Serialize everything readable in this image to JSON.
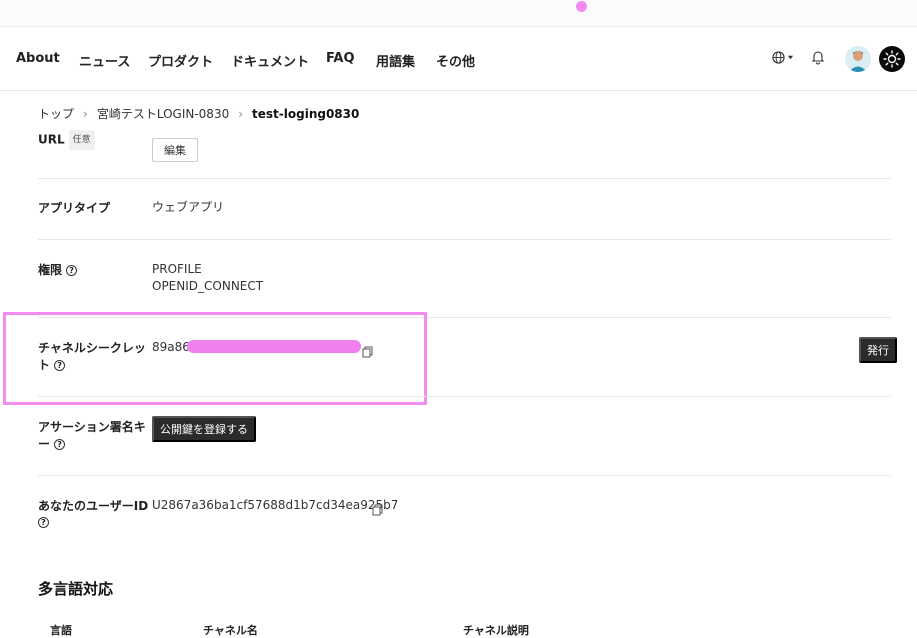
{
  "nav": {
    "items": [
      "About",
      "ニュース",
      "プロダクト",
      "ドキュメント",
      "FAQ",
      "用語集",
      "その他"
    ]
  },
  "breadcrumb": {
    "items": [
      "トップ",
      "宮崎テストLOGIN-0830",
      "test-loging0830"
    ]
  },
  "fields": {
    "url": {
      "label": "URL",
      "tag": "任意",
      "button": "編集"
    },
    "app_type": {
      "label": "アプリタイプ",
      "value": "ウェブアプリ"
    },
    "permissions": {
      "label": "権限",
      "values": [
        "PROFILE",
        "OPENID_CONNECT"
      ]
    },
    "channel_secret": {
      "label_line1": "チャネルシークレッ",
      "label_line2": "ト",
      "value_prefix": "89a86",
      "button": "発行"
    },
    "assertion_key": {
      "label_line1": "アサーション署名キ",
      "label_line2": "ー",
      "button": "公開鍵を登録する"
    },
    "user_id": {
      "label": "あなたのユーザーID",
      "value": "U2867a36ba1cf57688d1b7cd34ea925b7"
    }
  },
  "i18n": {
    "title": "多言語対応",
    "columns": [
      "言語",
      "チャネル名",
      "チャネル説明"
    ]
  },
  "colors": {
    "highlight": "#f48cf0",
    "dark_button": "#2b2b2b"
  }
}
